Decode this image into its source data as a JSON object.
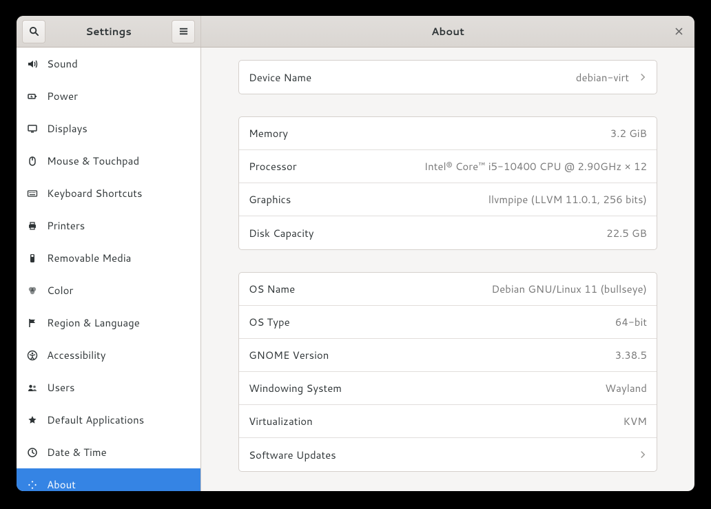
{
  "header": {
    "title_left": "Settings",
    "title_right": "About"
  },
  "sidebar": {
    "items": [
      {
        "id": "sound",
        "label": "Sound",
        "icon": "speaker"
      },
      {
        "id": "power",
        "label": "Power",
        "icon": "battery"
      },
      {
        "id": "displays",
        "label": "Displays",
        "icon": "display"
      },
      {
        "id": "mouse",
        "label": "Mouse & Touchpad",
        "icon": "mouse"
      },
      {
        "id": "keyboard",
        "label": "Keyboard Shortcuts",
        "icon": "keyboard"
      },
      {
        "id": "printers",
        "label": "Printers",
        "icon": "printer"
      },
      {
        "id": "removable",
        "label": "Removable Media",
        "icon": "removable"
      },
      {
        "id": "color",
        "label": "Color",
        "icon": "color"
      },
      {
        "id": "region",
        "label": "Region & Language",
        "icon": "flag"
      },
      {
        "id": "accessibility",
        "label": "Accessibility",
        "icon": "accessibility"
      },
      {
        "id": "users",
        "label": "Users",
        "icon": "users"
      },
      {
        "id": "default",
        "label": "Default Applications",
        "icon": "star"
      },
      {
        "id": "datetime",
        "label": "Date & Time",
        "icon": "clock"
      },
      {
        "id": "about",
        "label": "About",
        "icon": "plus",
        "selected": true
      }
    ]
  },
  "about": {
    "device": {
      "label": "Device Name",
      "value": "debian-virt"
    },
    "hardware": [
      {
        "label": "Memory",
        "value": "3.2 GiB"
      },
      {
        "label": "Processor",
        "value": "Intel® Core™ i5-10400 CPU @ 2.90GHz × 12"
      },
      {
        "label": "Graphics",
        "value": "llvmpipe (LLVM 11.0.1, 256 bits)"
      },
      {
        "label": "Disk Capacity",
        "value": "22.5 GB"
      }
    ],
    "os": [
      {
        "label": "OS Name",
        "value": "Debian GNU/Linux 11 (bullseye)"
      },
      {
        "label": "OS Type",
        "value": "64-bit"
      },
      {
        "label": "GNOME Version",
        "value": "3.38.5"
      },
      {
        "label": "Windowing System",
        "value": "Wayland"
      },
      {
        "label": "Virtualization",
        "value": "KVM"
      }
    ],
    "updates": {
      "label": "Software Updates"
    }
  }
}
